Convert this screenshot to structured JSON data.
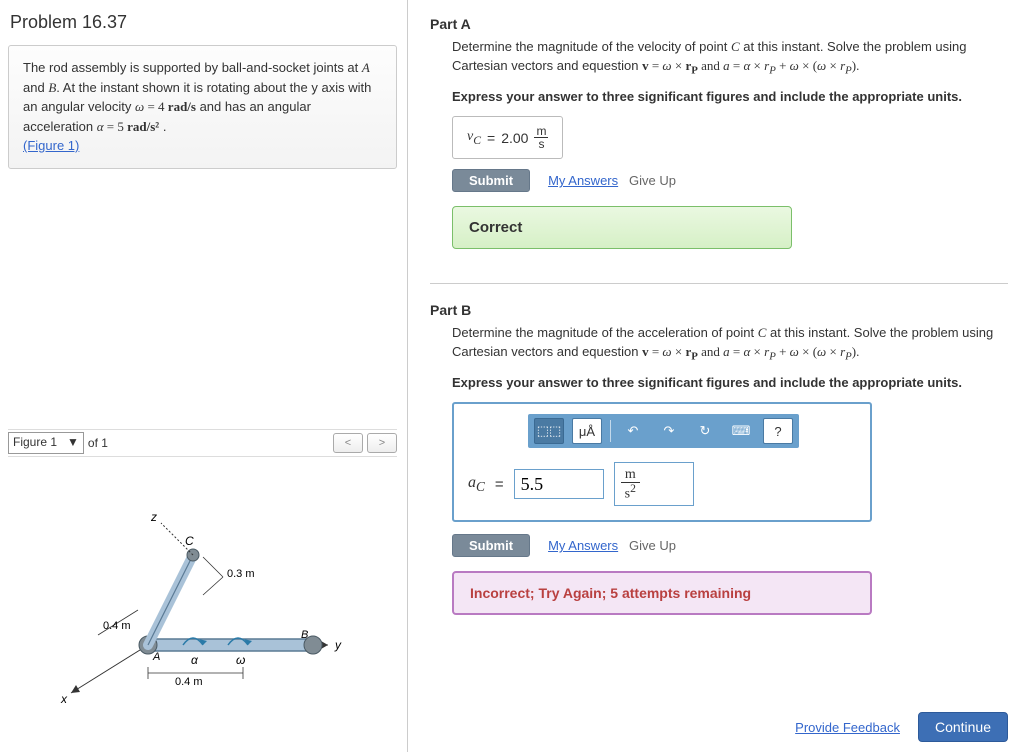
{
  "problem": {
    "title": "Problem 16.37",
    "statement_pre": "The rod assembly is supported by ball-and-socket joints at ",
    "pointA": "A",
    "mid1": " and ",
    "pointB": "B",
    "mid2": ". At the instant shown it is rotating about the y axis with an angular velocity ",
    "omega_sym": "ω",
    "eq1": " = 4 ",
    "unit_w": "rad/s",
    "mid3": " and has an angular acceleration ",
    "alpha_sym": "α",
    "eq2": " = 5 ",
    "unit_a": "rad/s²",
    "tail": " .",
    "figure_link": "(Figure 1)"
  },
  "figure": {
    "selector_label": "Figure 1",
    "of_text": "of 1",
    "labels": {
      "z": "z",
      "y": "y",
      "x": "x",
      "A": "A",
      "B": "B",
      "C": "C",
      "alpha": "α",
      "omega": "ω",
      "d1": "0.4 m",
      "d2": "0.4 m",
      "d3": "0.3 m"
    }
  },
  "partA": {
    "label": "Part A",
    "prompt_pre": "Determine the magnitude of the velocity of point ",
    "pointC": "C",
    "prompt_mid": " at this instant. Solve the problem using Cartesian vectors and equestion ",
    "eqn": "v = ω × r_P  and  a = α × r_P + ω × (ω × r_P).",
    "instr": "Express your answer to three significant figures and include the appropriate units.",
    "answer_var": "v_C",
    "answer_eq": " = ",
    "answer_val": "2.00",
    "answer_unit_num": "m",
    "answer_unit_den": "s",
    "submit": "Submit",
    "my_answers": "My Answers",
    "give_up": "Give Up",
    "feedback": "Correct"
  },
  "partB": {
    "label": "Part B",
    "prompt_pre": "Determine the magnitude of the acceleration of point ",
    "pointC": "C",
    "prompt_mid": " at this instant. Solve the problem using Cartesian vectors and equestion ",
    "eqn": "v = ω × r_P  and  a = α × r_P + ω × (ω × r_P).",
    "instr": "Express your answer to three significant figures and include the appropriate units.",
    "toolbar": {
      "templates": "⬚⬚",
      "units": "μÅ",
      "undo": "↶",
      "redo": "↷",
      "reset": "↻",
      "keyboard": "⌨",
      "help": "?"
    },
    "answer_var": "a_C",
    "answer_eq": " = ",
    "answer_val": "5.5",
    "answer_unit_num": "m",
    "answer_unit_den": "s",
    "answer_unit_exp": "2",
    "submit": "Submit",
    "my_answers": "My Answers",
    "give_up": "Give Up",
    "feedback": "Incorrect; Try Again; 5 attempts remaining"
  },
  "footer": {
    "provide_feedback": "Provide Feedback",
    "continue": "Continue"
  }
}
